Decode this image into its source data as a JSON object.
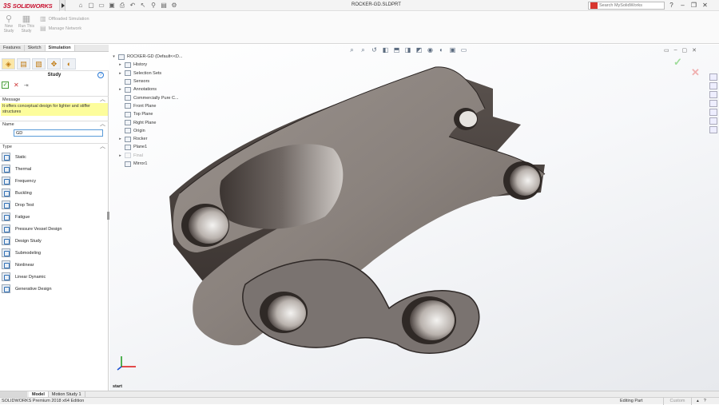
{
  "app": {
    "brand_ds": "3S",
    "brand_name": "SOLIDWORKS",
    "doc_title": "ROCKER-GD.SLDPRT"
  },
  "search": {
    "placeholder": "Search MySolidWorks"
  },
  "ribbon": {
    "new_study": "New Study",
    "run_study": "Run This Study",
    "offloaded": "Offloaded Simulation",
    "manage_network": "Manage Network"
  },
  "manager_tabs": [
    "Features",
    "Sketch",
    "Simulation"
  ],
  "panel": {
    "title": "Study",
    "help": "?",
    "message_header": "Message",
    "message": "It offers conceptual design for lighter and stiffer structures",
    "name_header": "Name",
    "name_value": "GD",
    "type_header": "Type",
    "types": [
      "Static",
      "Thermal",
      "Frequency",
      "Buckling",
      "Drop Test",
      "Fatigue",
      "Pressure Vessel Design",
      "Design Study",
      "Submodeling",
      "Nonlinear",
      "Linear Dynamic",
      "Generative Design"
    ]
  },
  "tree": {
    "root": "ROCKER-GD (Default<<D...",
    "items": [
      "History",
      "Selection Sets",
      "Sensors",
      "Annotations",
      "Commercially Pure C...",
      "Front Plane",
      "Top Plane",
      "Right Plane",
      "Origin",
      "Rocker",
      "Plane1",
      "Final",
      "Mirror1"
    ]
  },
  "viewport": {
    "start_label": "start"
  },
  "bottom_tabs": [
    "Model",
    "Motion Study 1"
  ],
  "status": {
    "left": "SOLIDWORKS Premium 2018 x64 Edition",
    "mode": "Editing Part",
    "units": "Custom"
  },
  "colors": {
    "brand": "#c8102e",
    "part_fill": "#7f7772",
    "part_dark": "#2e2826",
    "message_bg": "#fdfd9c"
  }
}
